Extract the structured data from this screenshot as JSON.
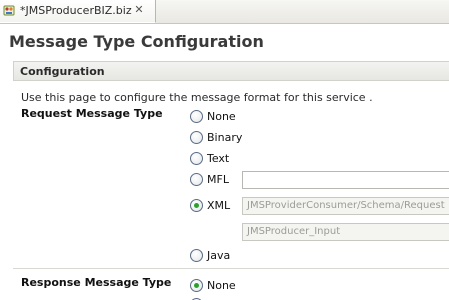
{
  "tab": {
    "label": "*JMSProducerBIZ.biz",
    "close_glyph": "✕",
    "icon": "business-service-icon"
  },
  "page": {
    "title": "Message Type Configuration"
  },
  "section": {
    "title": "Configuration",
    "description": "Use this page to configure the message format for this service ."
  },
  "request": {
    "label": "Request Message Type",
    "options": [
      {
        "label": "None",
        "checked": false
      },
      {
        "label": "Binary",
        "checked": false
      },
      {
        "label": "Text",
        "checked": false
      },
      {
        "label": "MFL",
        "checked": false
      },
      {
        "label": "XML",
        "checked": true
      },
      {
        "label": "Java",
        "checked": false
      }
    ],
    "mfl_field_value": "",
    "xml_schema_value": "JMSProviderConsumer/Schema/Request",
    "xml_element_value": "JMSProducer_Input"
  },
  "response": {
    "label": "Response Message Type",
    "options": [
      {
        "label": "None",
        "checked": true
      }
    ]
  },
  "colors": {
    "radio_checked": "#2ca02c",
    "section_bg": "#e6e6e2"
  }
}
